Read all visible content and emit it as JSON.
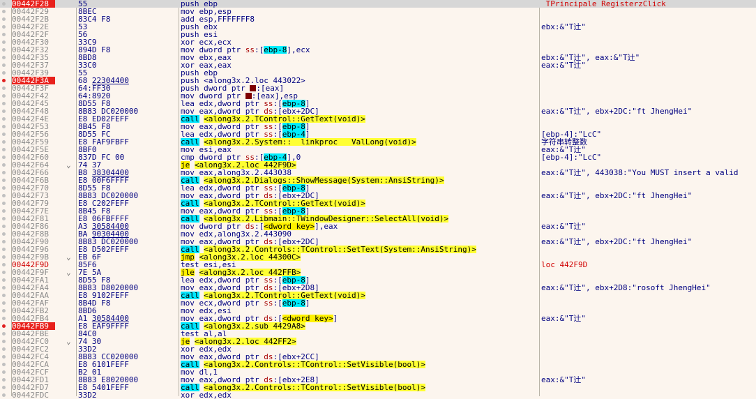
{
  "rows": [
    {
      "addr": "00442F28",
      "br": "",
      "bytes": "55",
      "dis": "push ebp",
      "comment": "_TPrincipale_RegisterzClick",
      "addr_style": "cur",
      "dot": "grey",
      "current": true
    },
    {
      "addr": "00442F29",
      "br": "",
      "bytes": "8BEC",
      "dis": "mov ebp,esp",
      "comment": ""
    },
    {
      "addr": "00442F2B",
      "br": "",
      "bytes": "83C4 F8",
      "dis": "add esp,FFFFFFF8",
      "comment": ""
    },
    {
      "addr": "00442F2E",
      "br": "",
      "bytes": "53",
      "dis": "push ebx",
      "comment": "ebx:&\"T辻\""
    },
    {
      "addr": "00442F2F",
      "br": "",
      "bytes": "56",
      "dis": "push esi",
      "comment": ""
    },
    {
      "addr": "00442F30",
      "br": "",
      "bytes": "33C9",
      "dis": "xor ecx,ecx",
      "comment": ""
    },
    {
      "addr": "00442F32",
      "br": "",
      "bytes": "894D F8",
      "dis": "mov dword ptr ss:[ebp-8],ecx",
      "comment": ""
    },
    {
      "addr": "00442F35",
      "br": "",
      "bytes": "8BD8",
      "dis": "mov ebx,eax",
      "comment": "ebx:&\"T辻\", eax:&\"T辻\""
    },
    {
      "addr": "00442F37",
      "br": "",
      "bytes": "33C0",
      "dis": "xor eax,eax",
      "comment": "eax:&\"T辻\""
    },
    {
      "addr": "00442F39",
      "br": "",
      "bytes": "55",
      "dis": "push ebp",
      "comment": ""
    },
    {
      "addr": "00442F3A",
      "br": "",
      "bytes": "68 22304400",
      "dis": "push <along3x.2.loc_443022>",
      "comment": "",
      "addr_style": "bp",
      "dot": "red"
    },
    {
      "addr": "00442F3F",
      "br": "",
      "bytes": "64:FF30",
      "dis": "push dword ptr fs:[eax]",
      "comment": ""
    },
    {
      "addr": "00442F42",
      "br": "",
      "bytes": "64:8920",
      "dis": "mov dword ptr fs:[eax],esp",
      "comment": ""
    },
    {
      "addr": "00442F45",
      "br": "",
      "bytes": "8D55 F8",
      "dis": "lea edx,dword ptr ss:[ebp-8]",
      "comment": ""
    },
    {
      "addr": "00442F48",
      "br": "",
      "bytes": "8B83 DC020000",
      "dis": "mov eax,dword ptr ds:[ebx+2DC]",
      "comment": "eax:&\"T辻\", ebx+2DC:\"ft JhengHei\""
    },
    {
      "addr": "00442F4E",
      "br": "",
      "bytes": "E8 ED02FEFF",
      "dis": "call <along3x.2.TControl::GetText(void)>",
      "comment": ""
    },
    {
      "addr": "00442F53",
      "br": "",
      "bytes": "8B45 F8",
      "dis": "mov eax,dword ptr ss:[ebp-8]",
      "comment": ""
    },
    {
      "addr": "00442F56",
      "br": "",
      "bytes": "8D55 FC",
      "dis": "lea edx,dword ptr ss:[ebp-4]",
      "comment": "[ebp-4]:\"LcC\""
    },
    {
      "addr": "00442F59",
      "br": "",
      "bytes": "E8 FAF9FBFF",
      "dis": "call <along3x.2.System::__linkproc__ ValLong(void)>",
      "comment": "字符串转整数"
    },
    {
      "addr": "00442F5E",
      "br": "",
      "bytes": "8BF0",
      "dis": "mov esi,eax",
      "comment": "eax:&\"T辻\""
    },
    {
      "addr": "00442F60",
      "br": "",
      "bytes": "837D FC 00",
      "dis": "cmp dword ptr ss:[ebp-4],0",
      "comment": "[ebp-4]:\"LcC\""
    },
    {
      "addr": "00442F64",
      "br": "⌄",
      "bytes": "74 37",
      "dis": "je <along3x.2.loc_442F9D>",
      "comment": ""
    },
    {
      "addr": "00442F66",
      "br": "",
      "bytes": "B8 38304400",
      "dis": "mov eax,along3x.2.443038",
      "comment": "eax:&\"T辻\", 443038:\"You MUST insert a valid"
    },
    {
      "addr": "00442F6B",
      "br": "",
      "bytes": "E8 00F6FFFF",
      "dis": "call <along3x.2.Dialogs::ShowMessage(System::AnsiString)>",
      "comment": ""
    },
    {
      "addr": "00442F70",
      "br": "",
      "bytes": "8D55 F8",
      "dis": "lea edx,dword ptr ss:[ebp-8]",
      "comment": ""
    },
    {
      "addr": "00442F73",
      "br": "",
      "bytes": "8B83 DC020000",
      "dis": "mov eax,dword ptr ds:[ebx+2DC]",
      "comment": "eax:&\"T辻\", ebx+2DC:\"ft JhengHei\""
    },
    {
      "addr": "00442F79",
      "br": "",
      "bytes": "E8 C202FEFF",
      "dis": "call <along3x.2.TControl::GetText(void)>",
      "comment": ""
    },
    {
      "addr": "00442F7E",
      "br": "",
      "bytes": "8B45 F8",
      "dis": "mov eax,dword ptr ss:[ebp-8]",
      "comment": ""
    },
    {
      "addr": "00442F81",
      "br": "",
      "bytes": "E8 06FBFFFF",
      "dis": "call <along3x.2.Libmain::TWindowDesigner::SelectAll(void)>",
      "comment": ""
    },
    {
      "addr": "00442F86",
      "br": "",
      "bytes": "A3 30584400",
      "dis": "mov dword ptr ds:[<dword_key>],eax",
      "comment": "eax:&\"T辻\""
    },
    {
      "addr": "00442F8B",
      "br": "",
      "bytes": "BA 90304400",
      "dis": "mov edx,along3x.2.443090",
      "comment": ""
    },
    {
      "addr": "00442F90",
      "br": "",
      "bytes": "8B83 DC020000",
      "dis": "mov eax,dword ptr ds:[ebx+2DC]",
      "comment": "eax:&\"T辻\", ebx+2DC:\"ft JhengHei\""
    },
    {
      "addr": "00442F96",
      "br": "",
      "bytes": "E8 D502FEFF",
      "dis": "call <along3x.2.Controls::TControl::SetText(System::AnsiString)>",
      "comment": ""
    },
    {
      "addr": "00442F9B",
      "br": "⌄",
      "bytes": "EB 6F",
      "dis": "jmp <along3x.2.loc_44300C>",
      "comment": ""
    },
    {
      "addr": "00442F9D",
      "br": "",
      "bytes": "85F6",
      "dis": "test esi,esi",
      "comment": "loc_442F9D",
      "addr_style": "lbl"
    },
    {
      "addr": "00442F9F",
      "br": "⌄",
      "bytes": "7E 5A",
      "dis": "jle <along3x.2.loc_442FFB>",
      "comment": ""
    },
    {
      "addr": "00442FA1",
      "br": "",
      "bytes": "8D55 F8",
      "dis": "lea edx,dword ptr ss:[ebp-8]",
      "comment": ""
    },
    {
      "addr": "00442FA4",
      "br": "",
      "bytes": "8B83 D8020000",
      "dis": "mov eax,dword ptr ds:[ebx+2D8]",
      "comment": "eax:&\"T辻\", ebx+2D8:\"rosoft JhengHei\""
    },
    {
      "addr": "00442FAA",
      "br": "",
      "bytes": "E8 9102FEFF",
      "dis": "call <along3x.2.TControl::GetText(void)>",
      "comment": ""
    },
    {
      "addr": "00442FAF",
      "br": "",
      "bytes": "8B4D F8",
      "dis": "mov ecx,dword ptr ss:[ebp-8]",
      "comment": ""
    },
    {
      "addr": "00442FB2",
      "br": "",
      "bytes": "8BD6",
      "dis": "mov edx,esi",
      "comment": ""
    },
    {
      "addr": "00442FB4",
      "br": "",
      "bytes": "A1 30584400",
      "dis": "mov eax,dword ptr ds:[<dword_key>]",
      "comment": "eax:&\"T辻\""
    },
    {
      "addr": "00442FB9",
      "br": "",
      "bytes": "E8 EAF9FFFF",
      "dis": "call <along3x.2.sub_4429A8>",
      "comment": "",
      "addr_style": "bp",
      "dot": "red"
    },
    {
      "addr": "00442FBE",
      "br": "",
      "bytes": "84C0",
      "dis": "test al,al",
      "comment": ""
    },
    {
      "addr": "00442FC0",
      "br": "⌄",
      "bytes": "74 30",
      "dis": "je <along3x.2.loc_442FF2>",
      "comment": ""
    },
    {
      "addr": "00442FC2",
      "br": "",
      "bytes": "33D2",
      "dis": "xor edx,edx",
      "comment": ""
    },
    {
      "addr": "00442FC4",
      "br": "",
      "bytes": "8B83 CC020000",
      "dis": "mov eax,dword ptr ds:[ebx+2CC]",
      "comment": ""
    },
    {
      "addr": "00442FCA",
      "br": "",
      "bytes": "E8 6101FEFF",
      "dis": "call <along3x.2.Controls::TControl::SetVisible(bool)>",
      "comment": ""
    },
    {
      "addr": "00442FCF",
      "br": "",
      "bytes": "B2 01",
      "dis": "mov dl,1",
      "comment": ""
    },
    {
      "addr": "00442FD1",
      "br": "",
      "bytes": "8B83 E8020000",
      "dis": "mov eax,dword ptr ds:[ebx+2E8]",
      "comment": "eax:&\"T辻\""
    },
    {
      "addr": "00442FD7",
      "br": "",
      "bytes": "E8 5401FEFF",
      "dis": "call <along3x.2.Controls::TControl::SetVisible(bool)>",
      "comment": ""
    },
    {
      "addr": "00442FDC",
      "br": "",
      "bytes": "33D2",
      "dis": "xor edx,edx",
      "comment": ""
    }
  ]
}
